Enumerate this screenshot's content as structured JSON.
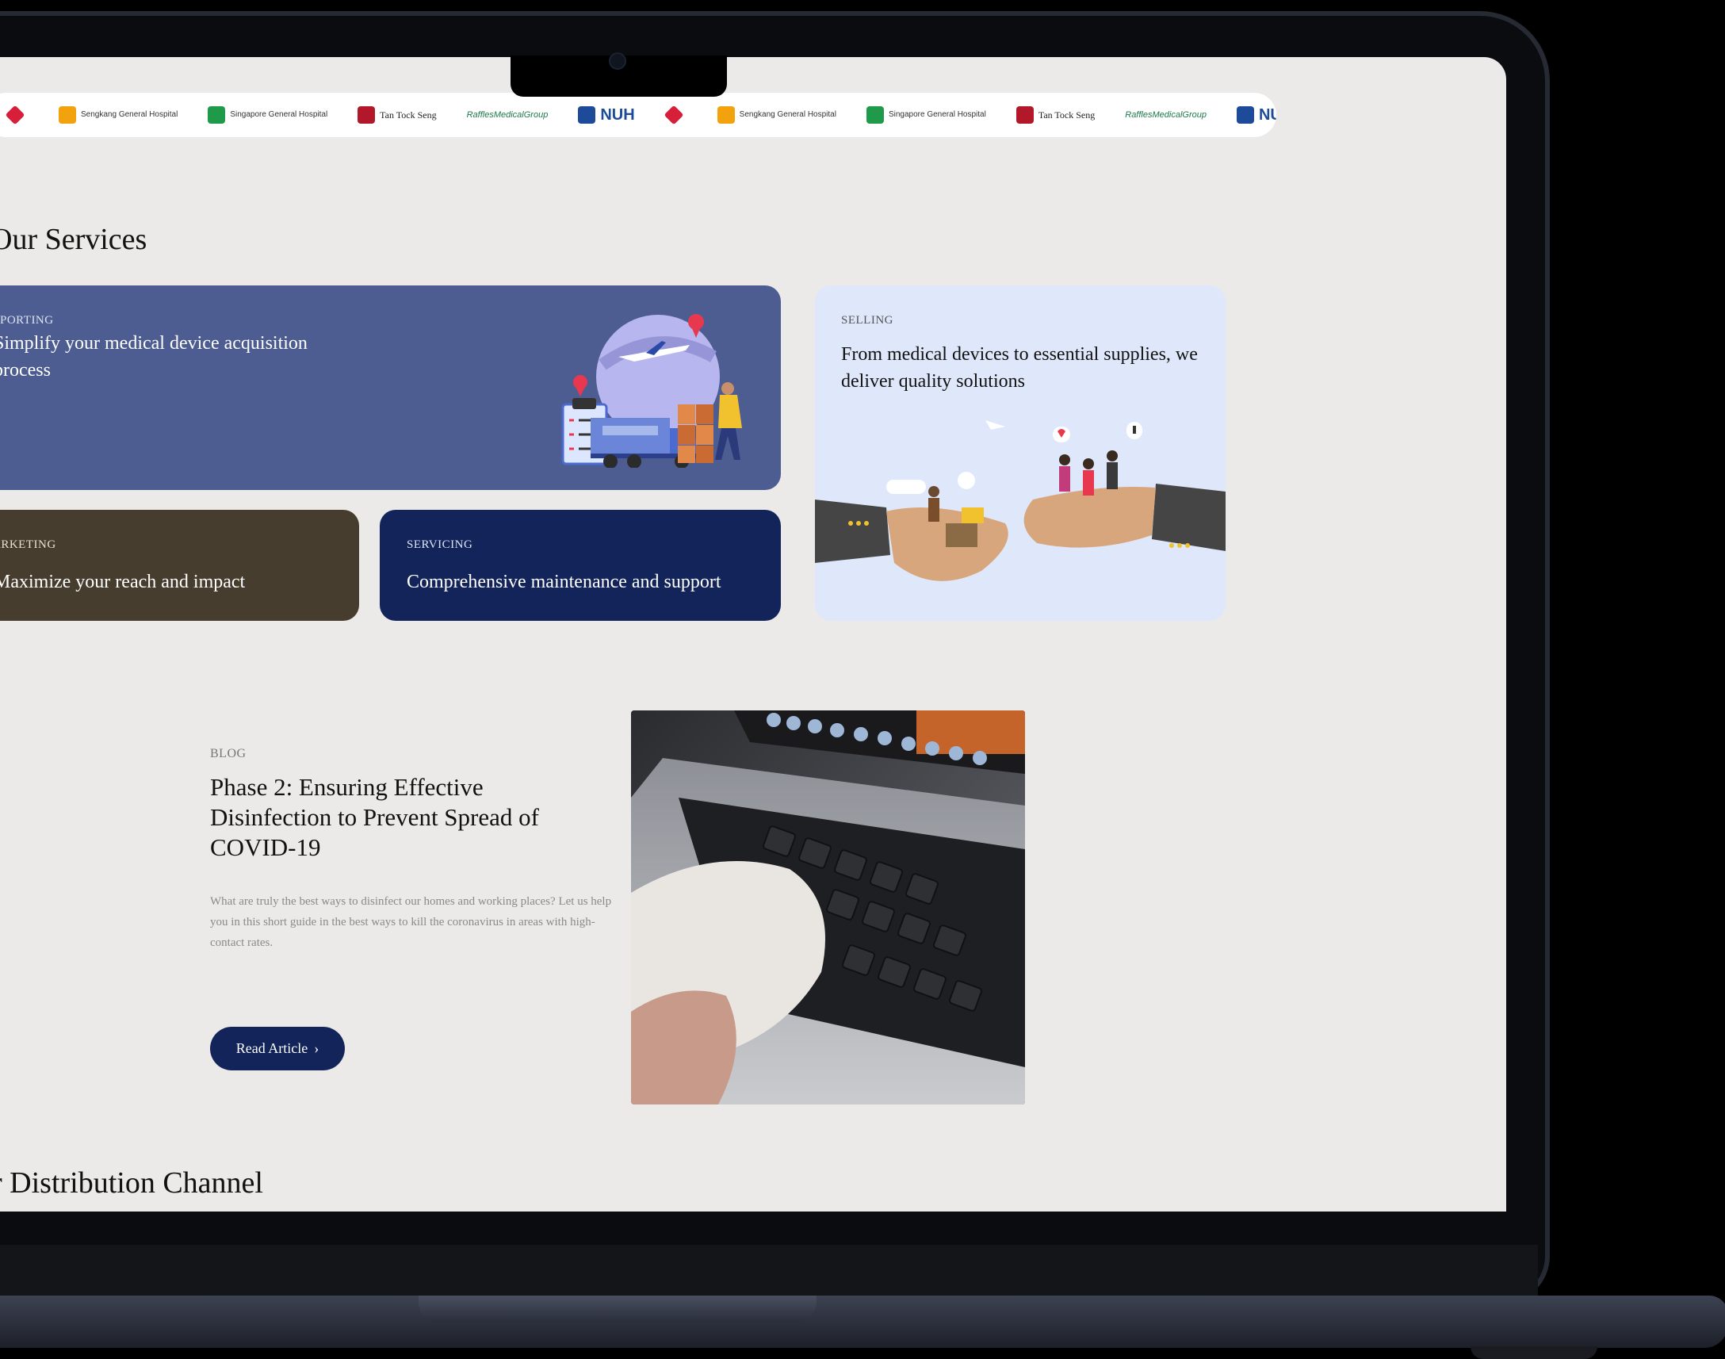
{
  "logos": [
    {
      "name": "red-logo",
      "label": "",
      "color": "#d81f3a"
    },
    {
      "name": "sengkang",
      "label": "Sengkang General Hospital",
      "color": "#f2a20c"
    },
    {
      "name": "sgh",
      "label": "Singapore General Hospital",
      "color": "#1f9a4a"
    },
    {
      "name": "ttsh",
      "label": "Tan Tock Seng",
      "color": "#b3182a"
    },
    {
      "name": "raffles",
      "label": "RafflesMedicalGroup",
      "color": "#1d7a4a"
    },
    {
      "name": "nuh",
      "label": "NUH",
      "color": "#1d4b9a"
    },
    {
      "name": "red-logo",
      "label": "",
      "color": "#d81f3a"
    },
    {
      "name": "sengkang",
      "label": "Sengkang General Hospital",
      "color": "#f2a20c"
    },
    {
      "name": "sgh",
      "label": "Singapore General Hospital",
      "color": "#1f9a4a"
    },
    {
      "name": "ttsh",
      "label": "Tan Tock Seng",
      "color": "#b3182a"
    },
    {
      "name": "raffles",
      "label": "RafflesMedicalGroup",
      "color": "#1d7a4a"
    },
    {
      "name": "nuh",
      "label": "NUH",
      "color": "#1d4b9a"
    },
    {
      "name": "red-logo",
      "label": "",
      "color": "#d81f3a"
    },
    {
      "name": "sengkang",
      "label": "Sengkang General Hospital",
      "color": "#f2a20c"
    }
  ],
  "services": {
    "title": "Our Services",
    "importing": {
      "tag": "PORTING",
      "desc": "Simplify your medical device acquisition process"
    },
    "marketing": {
      "tag": "ARKETING",
      "desc": "Maximize your reach and impact"
    },
    "servicing": {
      "tag": "SERVICING",
      "desc": "Comprehensive maintenance and support"
    },
    "selling": {
      "tag": "SELLING",
      "desc": "From medical devices to essential supplies, we deliver quality solutions"
    }
  },
  "blog": {
    "tag": "BLOG",
    "title": "Phase 2: Ensuring Effective Disinfection to Prevent Spread of COVID-19",
    "excerpt": "What are truly the best ways to disinfect our homes and working places? Let us help you in this short guide in the best ways to kill the coronavirus in areas with high-contact rates.",
    "button": "Read Article"
  },
  "distribution": {
    "title": "r Distribution Channel"
  },
  "colors": {
    "navy": "#13245a",
    "importing": "#4d5d91",
    "marketing": "#473d2e",
    "selling": "#dfe7fb",
    "page_bg": "#ebeae8"
  }
}
